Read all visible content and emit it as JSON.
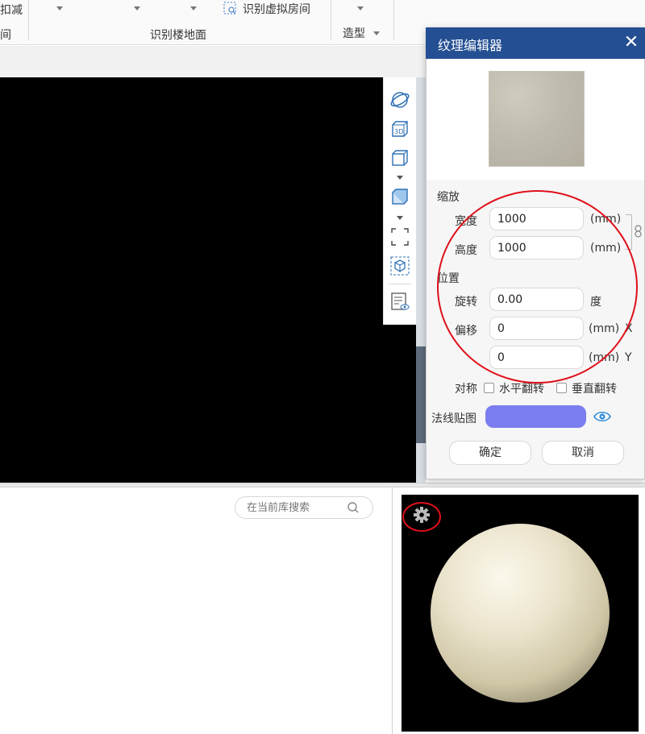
{
  "ribbon": {
    "left_label": "扣减",
    "left_label2": "间",
    "identify_virtual_room": "识别虚拟房间",
    "group_label": "识别楼地面",
    "modeling_label": "造型"
  },
  "search": {
    "placeholder": "在当前库搜索"
  },
  "texture_editor": {
    "title": "纹理编辑器",
    "scale_section": "缩放",
    "width_label": "宽度",
    "width_value": "1000",
    "height_label": "高度",
    "height_value": "1000",
    "unit_mm": "(mm)",
    "position_section": "位置",
    "rotation_label": "旋转",
    "rotation_value": "0.00",
    "rotation_unit": "度",
    "offset_label": "偏移",
    "offset_x_value": "0",
    "offset_y_value": "0",
    "axis_x": "X",
    "axis_y": "Y",
    "symmetry_label": "对称",
    "flip_horizontal": "水平翻转",
    "flip_vertical": "垂直翻转",
    "normal_map_label": "法线贴图",
    "normal_map_color": "#7b7ef0",
    "ok_button": "确定",
    "cancel_button": "取消"
  },
  "colors": {
    "title_bar": "#244f93",
    "annotation_red": "#e0101a"
  }
}
